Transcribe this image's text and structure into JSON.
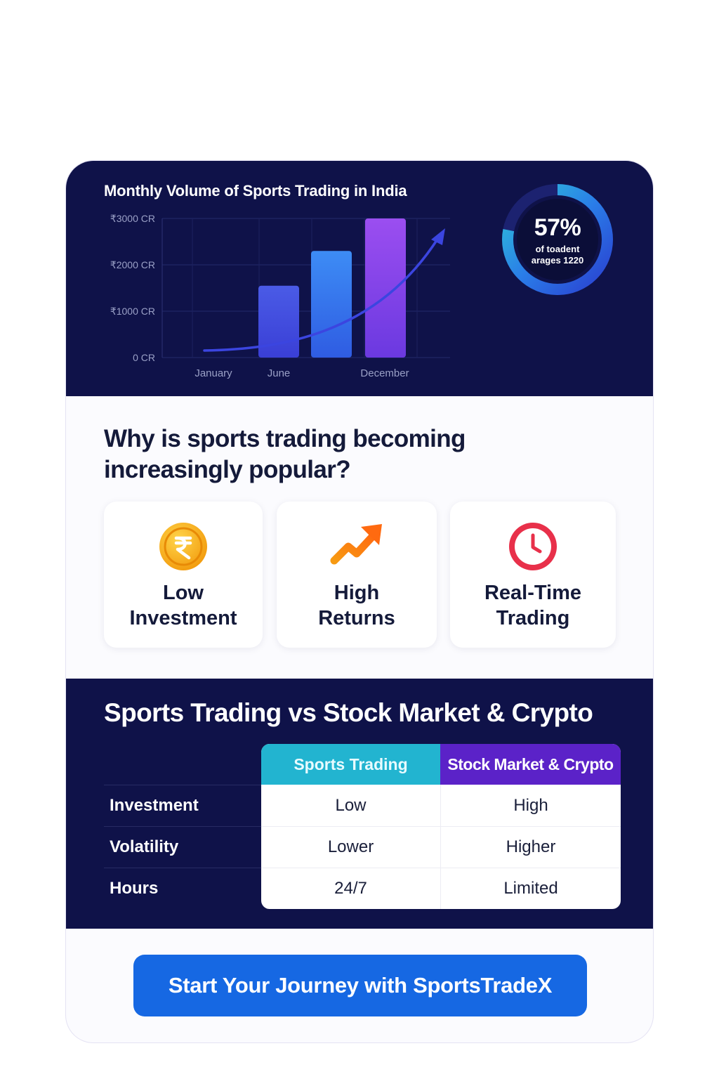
{
  "chart": {
    "title": "Monthly Volume of Sports Trading in India",
    "donut": {
      "percent_label": "57%",
      "percent_value": 57,
      "sub_line1": "of toadent",
      "sub_line2": "arages 1220"
    }
  },
  "chart_data": {
    "type": "bar",
    "title": "Monthly Volume of Sports Trading in India",
    "x_labels": [
      "January",
      "June",
      "December"
    ],
    "y_ticks": [
      "0 CR",
      "₹1000 CR",
      "₹2000 CR",
      "₹3000 CR"
    ],
    "ylim": [
      0,
      3000
    ],
    "categories": [
      "",
      "",
      ""
    ],
    "values": [
      1550,
      2300,
      3000
    ],
    "trend_line": true,
    "grid": true
  },
  "why": {
    "title": "Why is sports trading becoming increasingly popular?",
    "features": [
      {
        "icon": "rupee-coin-icon",
        "line1": "Low",
        "line2": "Investment"
      },
      {
        "icon": "trending-up-arrow-icon",
        "line1": "High",
        "line2": "Returns"
      },
      {
        "icon": "clock-icon",
        "line1": "Real-Time",
        "line2": "Trading"
      }
    ]
  },
  "compare": {
    "title": "Sports Trading vs Stock Market & Crypto",
    "columns": [
      "Sports Trading",
      "Stock Market & Crypto"
    ],
    "rows": [
      {
        "label": "Investment",
        "sports": "Low",
        "stock": "High"
      },
      {
        "label": "Volatility",
        "sports": "Lower",
        "stock": "Higher"
      },
      {
        "label": "Hours",
        "sports": "24/7",
        "stock": "Limited"
      }
    ]
  },
  "cta": {
    "label": "Start Your Journey with SportsTradeX"
  },
  "colors": {
    "navy": "#0f1249",
    "cta_blue": "#1668e3",
    "sports_header": "#22b4d0",
    "stock_header": "#5b22c8"
  }
}
